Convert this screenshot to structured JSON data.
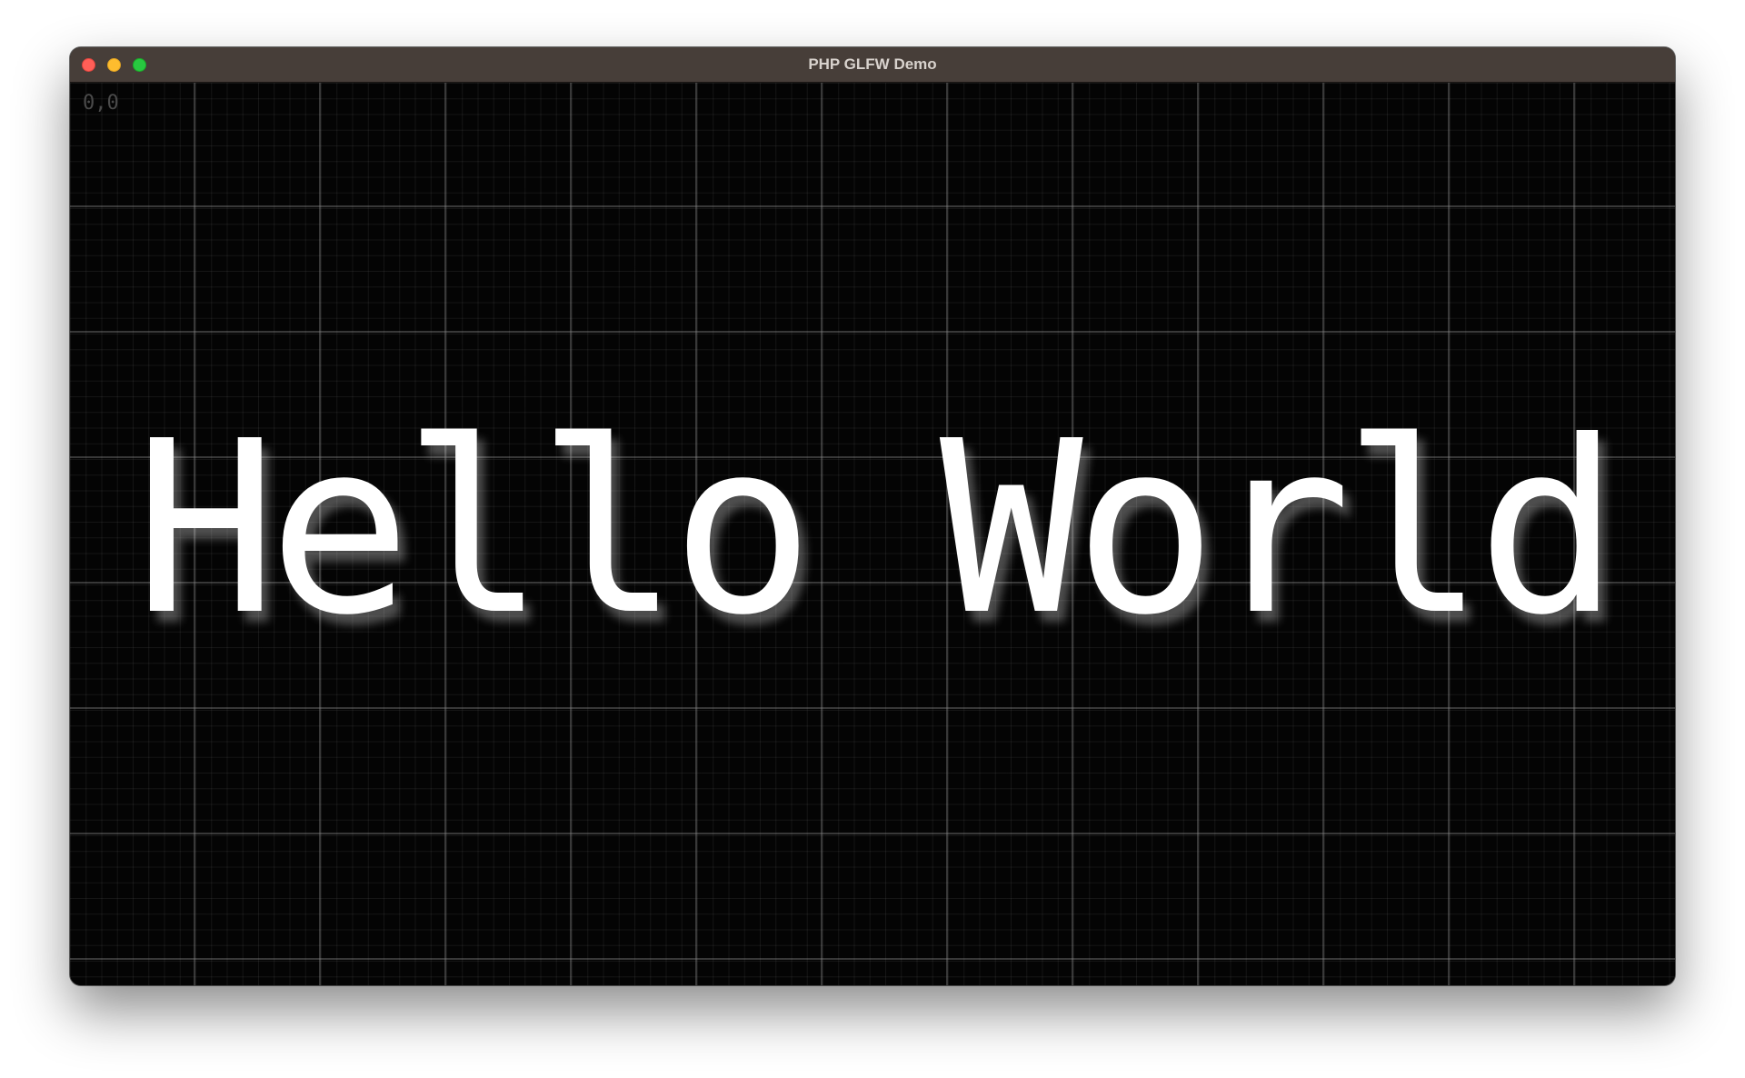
{
  "window": {
    "title": "PHP GLFW Demo",
    "controls": [
      "close",
      "minimize",
      "zoom"
    ]
  },
  "canvas": {
    "coordinate_label": "0,0",
    "text": "Hello World"
  }
}
